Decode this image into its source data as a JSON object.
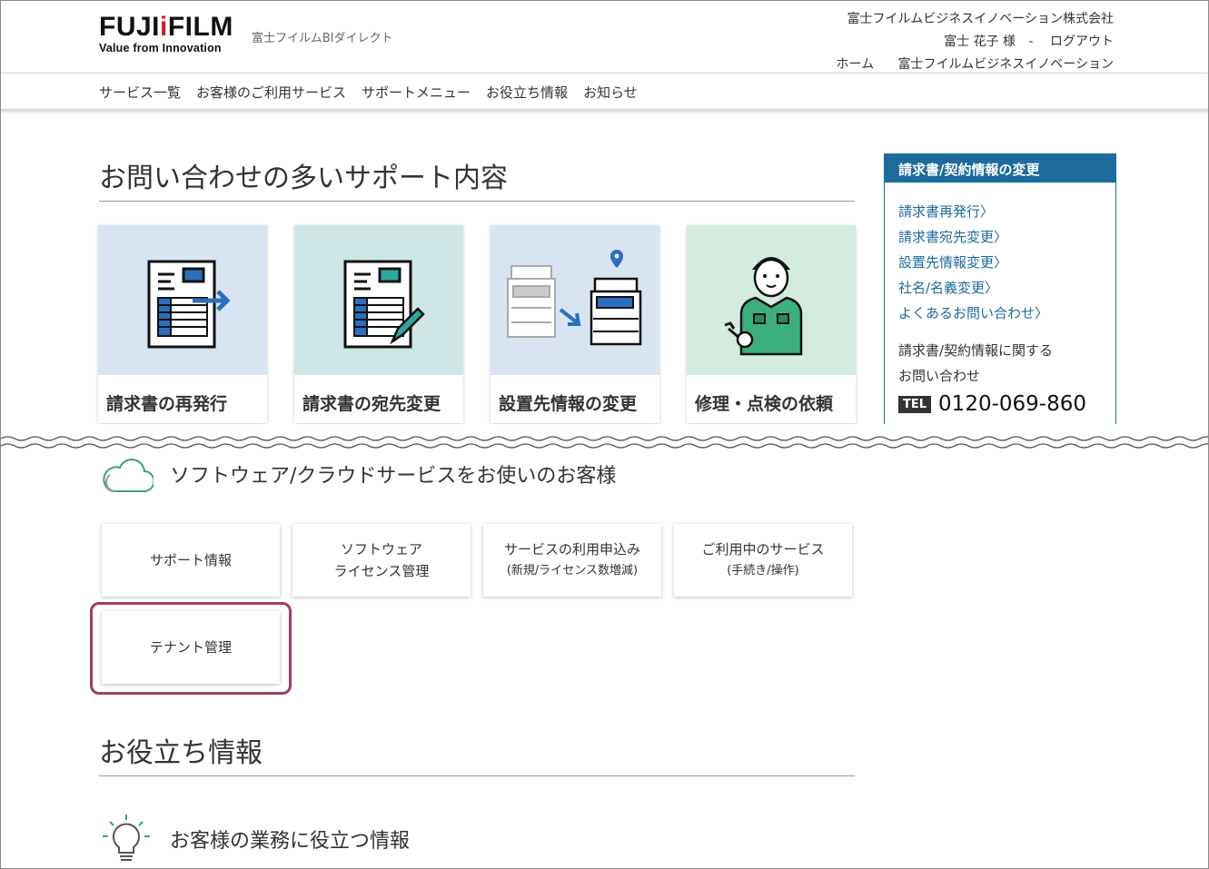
{
  "header": {
    "logo_left": "FUJI",
    "logo_mark": "i",
    "logo_right": "FILM",
    "logo_tagline": "Value from Innovation",
    "site_name": "富士フイルムBIダイレクト",
    "company": "富士フイルムビジネスイノベーション株式会社",
    "user_name": "富士 花子 様",
    "separator": "-",
    "logout": "ログアウト",
    "home": "ホーム",
    "company_link": "富士フイルムビジネスイノベーション"
  },
  "gnav": [
    "サービス一覧",
    "お客様のご利用サービス",
    "サポートメニュー",
    "お役立ち情報",
    "お知らせ"
  ],
  "support": {
    "title": "お問い合わせの多いサポート内容",
    "cards": [
      {
        "label": "請求書の再発行",
        "bg": "#d8e4f2"
      },
      {
        "label": "請求書の宛先変更",
        "bg": "#cfe6e6"
      },
      {
        "label": "設置先情報の変更",
        "bg": "#d8e4f2"
      },
      {
        "label": "修理・点検の依頼",
        "bg": "#d4ebe0"
      }
    ]
  },
  "sidebar": {
    "title": "請求書/契約情報の変更",
    "links": [
      "請求書再発行〉",
      "請求書宛先変更〉",
      "設置先情報変更〉",
      "社名/名義変更〉",
      "よくあるお問い合わせ〉"
    ],
    "note_line1": "請求書/契約情報に関する",
    "note_line2": "お問い合わせ",
    "tel_badge": "TEL",
    "tel_number": "0120-069-860"
  },
  "software": {
    "title": "ソフトウェア/クラウドサービスをお使いのお客様",
    "buttons": [
      {
        "line1": "サポート情報",
        "line2": "",
        "sub": ""
      },
      {
        "line1": "ソフトウェア",
        "line2": "ライセンス管理",
        "sub": ""
      },
      {
        "line1": "サービスの利用申込み",
        "line2": "",
        "sub": "(新規/ライセンス数増減)"
      },
      {
        "line1": "ご利用中のサービス",
        "line2": "",
        "sub": "(手続き/操作)"
      },
      {
        "line1": "テナント管理",
        "line2": "",
        "sub": ""
      }
    ]
  },
  "tips": {
    "title": "お役立ち情報",
    "sub_title": "お客様の業務に役立つ情報"
  },
  "colors": {
    "accent_blue": "#1d6a9c",
    "highlight": "#a13c6b",
    "brand_red": "#d71920"
  }
}
